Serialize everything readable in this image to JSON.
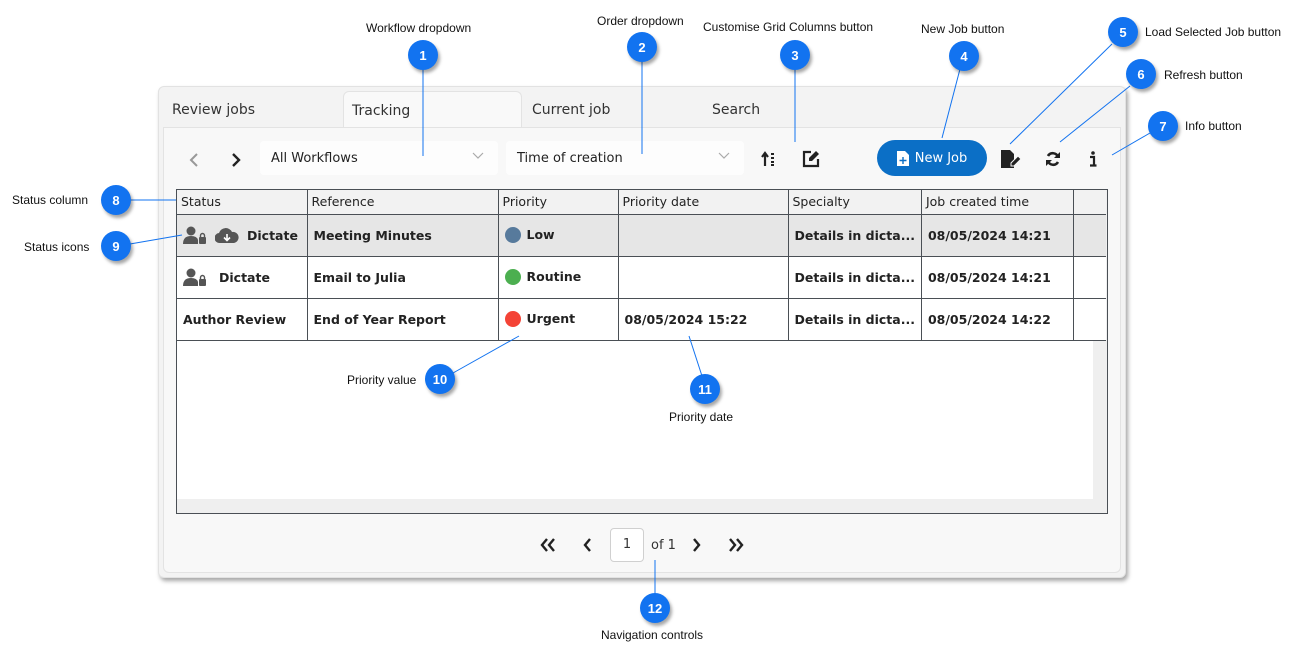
{
  "tabs": [
    {
      "label": "Review jobs",
      "active": false
    },
    {
      "label": "Tracking",
      "active": true
    },
    {
      "label": "Current job",
      "active": false
    },
    {
      "label": "Search",
      "active": false
    }
  ],
  "toolbar": {
    "workflow_value": "All Workflows",
    "order_value": "Time of creation",
    "new_job_label": "New Job"
  },
  "grid": {
    "columns": [
      "Status",
      "Reference",
      "Priority",
      "Priority date",
      "Specialty",
      "Job created time",
      ""
    ],
    "rows": [
      {
        "status": "Dictate",
        "status_icons": [
          "user-lock-icon",
          "cloud-download-icon"
        ],
        "reference": "Meeting Minutes",
        "priority": "Low",
        "priority_color": "#577a9c",
        "priority_date": "",
        "specialty": "Details in dicta...",
        "created": "08/05/2024 14:21",
        "selected": true
      },
      {
        "status": "Dictate",
        "status_icons": [
          "user-lock-icon"
        ],
        "reference": "Email to Julia",
        "priority": "Routine",
        "priority_color": "#4caf50",
        "priority_date": "",
        "specialty": "Details in dicta...",
        "created": "08/05/2024 14:21",
        "selected": false
      },
      {
        "status": "Author Review",
        "status_icons": [],
        "reference": "End of Year Report",
        "priority": "Urgent",
        "priority_color": "#f44336",
        "priority_date": "08/05/2024 15:22",
        "specialty": "Details in dicta...",
        "created": "08/05/2024 14:22",
        "selected": false
      }
    ]
  },
  "pager": {
    "current_page": "1",
    "of_label": "of 1"
  },
  "callouts": [
    {
      "num": "1",
      "label": "Workflow dropdown"
    },
    {
      "num": "2",
      "label": "Order dropdown"
    },
    {
      "num": "3",
      "label": "Customise Grid Columns button"
    },
    {
      "num": "4",
      "label": "New Job button"
    },
    {
      "num": "5",
      "label": "Load Selected Job button"
    },
    {
      "num": "6",
      "label": "Refresh button"
    },
    {
      "num": "7",
      "label": "Info button"
    },
    {
      "num": "8",
      "label": "Status column"
    },
    {
      "num": "9",
      "label": "Status icons"
    },
    {
      "num": "10",
      "label": "Priority value"
    },
    {
      "num": "11",
      "label": "Priority date"
    },
    {
      "num": "12",
      "label": "Navigation controls"
    }
  ],
  "colors": {
    "accent": "#0b6fc6",
    "callout": "#1273f0"
  }
}
